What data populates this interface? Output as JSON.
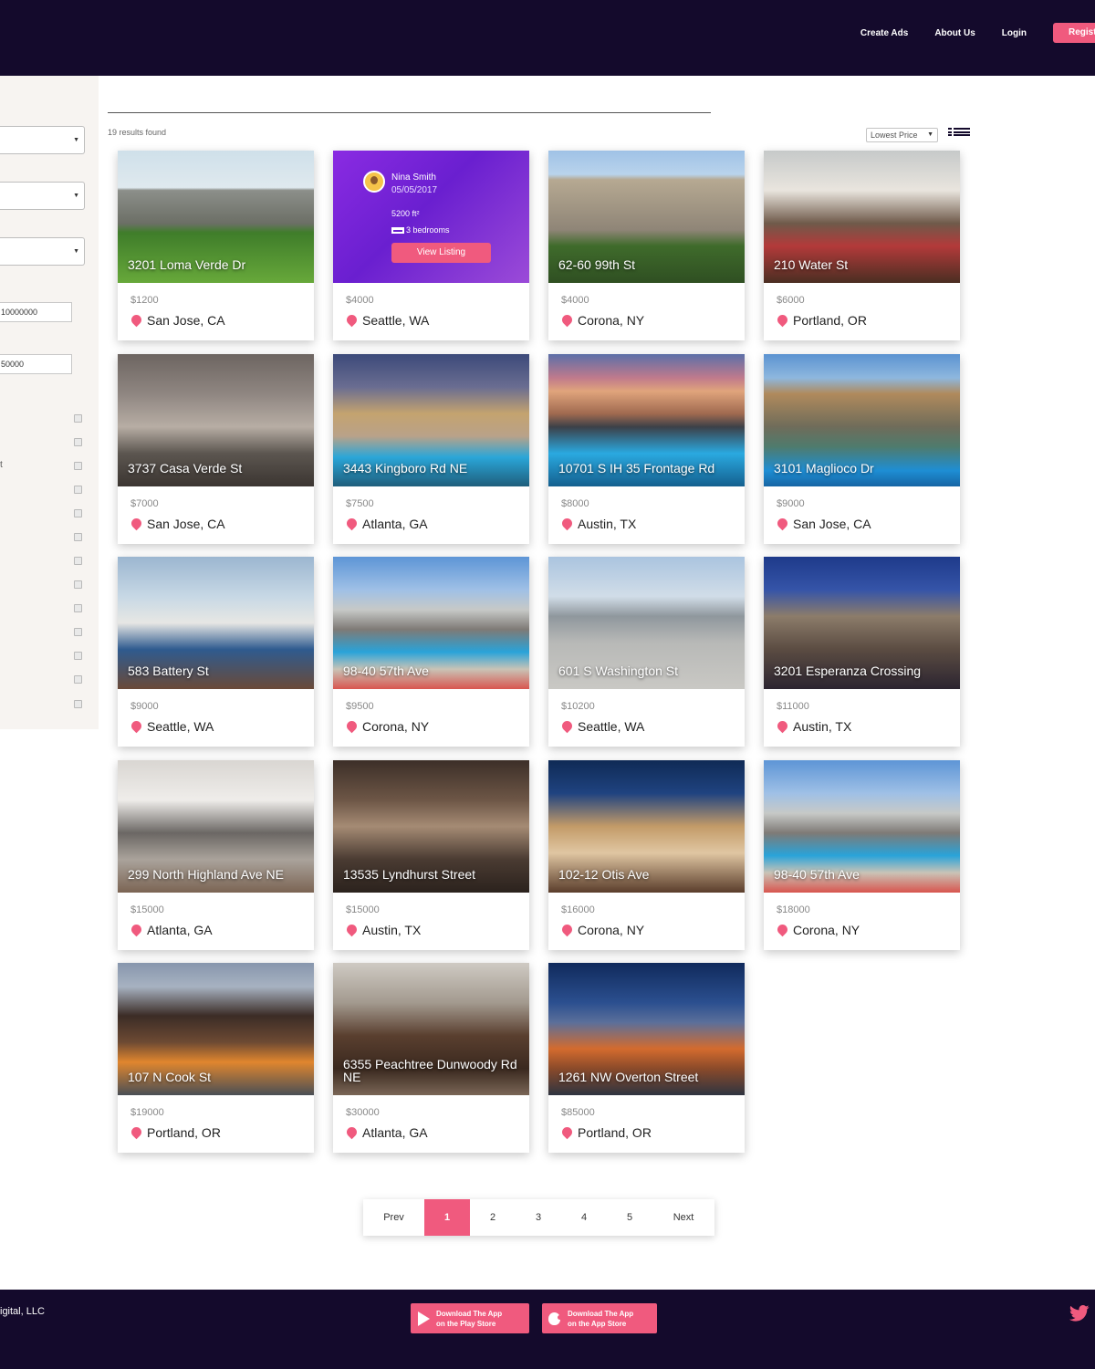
{
  "header": {
    "nav": [
      "Create Ads",
      "About Us",
      "Login"
    ],
    "register_label": "Register"
  },
  "sidebar": {
    "input_1": "10000000",
    "input_2": "50000",
    "stray_text": "t"
  },
  "results": {
    "count_text": "19 results found",
    "sort_value": "Lowest Price"
  },
  "featured": {
    "name": "Nina Smith",
    "date": "05/05/2017",
    "area": "5200 ft²",
    "beds": "3 bedrooms",
    "button": "View Listing"
  },
  "listings": [
    {
      "title": "3201 Loma Verde Dr",
      "price": "$1200",
      "location": "San Jose, CA",
      "scene": "garden"
    },
    {
      "title": "",
      "price": "$4000",
      "location": "Seattle, WA",
      "scene": "featured"
    },
    {
      "title": "62-60 99th St",
      "price": "$4000",
      "location": "Corona, NY",
      "scene": "tower"
    },
    {
      "title": "210 Water St",
      "price": "$6000",
      "location": "Portland, OR",
      "scene": "living"
    },
    {
      "title": "3737 Casa Verde St",
      "price": "$7000",
      "location": "San Jose, CA",
      "scene": "billiard"
    },
    {
      "title": "3443 Kingboro Rd NE",
      "price": "$7500",
      "location": "Atlanta, GA",
      "scene": "pool-dusk"
    },
    {
      "title": "10701 S IH 35 Frontage Rd",
      "price": "$8000",
      "location": "Austin, TX",
      "scene": "pool-sunset"
    },
    {
      "title": "3101 Maglioco Dr",
      "price": "$9000",
      "location": "San Jose, CA",
      "scene": "pool-day"
    },
    {
      "title": "583 Battery St",
      "price": "$9000",
      "location": "Seattle, WA",
      "scene": "view-room"
    },
    {
      "title": "98-40 57th Ave",
      "price": "$9500",
      "location": "Corona, NY",
      "scene": "rooftop-pool"
    },
    {
      "title": "601 S Washington St",
      "price": "$10200",
      "location": "Seattle, WA",
      "scene": "terrace"
    },
    {
      "title": "3201 Esperanza Crossing",
      "price": "$11000",
      "location": "Austin, TX",
      "scene": "building-night"
    },
    {
      "title": "299 North Highland Ave NE",
      "price": "$15000",
      "location": "Atlanta, GA",
      "scene": "kitchen"
    },
    {
      "title": "13535 Lyndhurst Street",
      "price": "$15000",
      "location": "Austin, TX",
      "scene": "lounge"
    },
    {
      "title": "102-12 Otis Ave",
      "price": "$16000",
      "location": "Corona, NY",
      "scene": "balcony-night"
    },
    {
      "title": "98-40 57th Ave",
      "price": "$18000",
      "location": "Corona, NY",
      "scene": "rooftop-pool"
    },
    {
      "title": "107 N Cook St",
      "price": "$19000",
      "location": "Portland, OR",
      "scene": "firepit"
    },
    {
      "title": "6355 Peachtree Dunwoody Rd NE",
      "price": "$30000",
      "location": "Atlanta, GA",
      "scene": "kitchen-dark"
    },
    {
      "title": "1261 NW Overton Street",
      "price": "$85000",
      "location": "Portland, OR",
      "scene": "deck-night"
    }
  ],
  "pagination": {
    "prev": "Prev",
    "pages": [
      "1",
      "2",
      "3",
      "4",
      "5"
    ],
    "current": "1",
    "next": "Next"
  },
  "footer": {
    "copyright": "igital, LLC",
    "play_line1": "Download The App",
    "play_line2": "on the Play Store",
    "app_line1": "Download The App",
    "app_line2": "on the App Store"
  },
  "colors": {
    "navy": "#140a2c",
    "accent": "#f05a7e",
    "sidebar_bg": "#f7f4f1"
  },
  "icons": [
    "list-view-icon",
    "location-pin-icon",
    "play-store-icon",
    "apple-icon",
    "twitter-icon",
    "bed-icon"
  ]
}
